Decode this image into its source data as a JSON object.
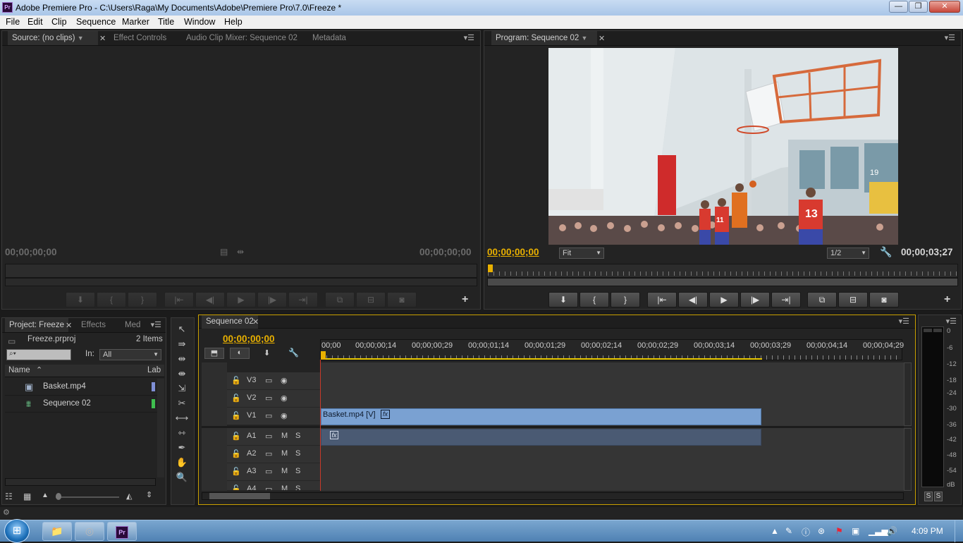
{
  "window": {
    "app_icon": "Pr",
    "title": "Adobe Premiere Pro - C:\\Users\\Raga\\My Documents\\Adobe\\Premiere Pro\\7.0\\Freeze *",
    "minimize": "—",
    "maximize": "❐",
    "close": "✕"
  },
  "menu": [
    "File",
    "Edit",
    "Clip",
    "Sequence",
    "Marker",
    "Title",
    "Window",
    "Help"
  ],
  "source_panel": {
    "tabs": [
      "Source: (no clips)",
      "Effect Controls",
      "Audio Clip Mixer: Sequence 02",
      "Metadata"
    ],
    "timecode_in": "00;00;00;00",
    "timecode_out": "00;00;00;00"
  },
  "program_panel": {
    "tab": "Program: Sequence 02",
    "timecode_current": "00;00;00;00",
    "timecode_duration": "00;00;03;27",
    "zoom": "Fit",
    "resolution": "1/2",
    "frame_labels": {
      "jersey_a": "13",
      "jersey_b": "11",
      "banner": "19"
    }
  },
  "project_panel": {
    "tabs": [
      "Project: Freeze",
      "Effects",
      "Med"
    ],
    "project_file": "Freeze.prproj",
    "item_count": "2 Items",
    "in_label": "In:",
    "in_value": "All",
    "columns": [
      "Name",
      "Lab"
    ],
    "items": [
      {
        "name": "Basket.mp4",
        "label_color": "#7f8fd6"
      },
      {
        "name": "Sequence 02",
        "label_color": "#3fbf4f"
      }
    ]
  },
  "timeline": {
    "tab": "Sequence 02",
    "timecode": "00;00;00;00",
    "ruler": [
      "00;00",
      "00;00;00;14",
      "00;00;00;29",
      "00;00;01;14",
      "00;00;01;29",
      "00;00;02;14",
      "00;00;02;29",
      "00;00;03;14",
      "00;00;03;29",
      "00;00;04;14",
      "00;00;04;29"
    ],
    "video_tracks": [
      "V3",
      "V2",
      "V1"
    ],
    "audio_tracks": [
      "A1",
      "A2",
      "A3",
      "A4"
    ],
    "mute_label": "M",
    "solo_label": "S",
    "video_clip": "Basket.mp4 [V]",
    "fx_badge": "fx",
    "clip_color": "#7aa1d2",
    "audio_clip_color": "#4a5a73"
  },
  "audio_meter": {
    "scale": [
      "0",
      "-6",
      "-12",
      "-18",
      "-24",
      "-30",
      "-36",
      "-42",
      "-48",
      "-54",
      "dB"
    ],
    "solo_buttons": [
      "S",
      "S"
    ]
  },
  "taskbar": {
    "clock": "4:09 PM"
  }
}
